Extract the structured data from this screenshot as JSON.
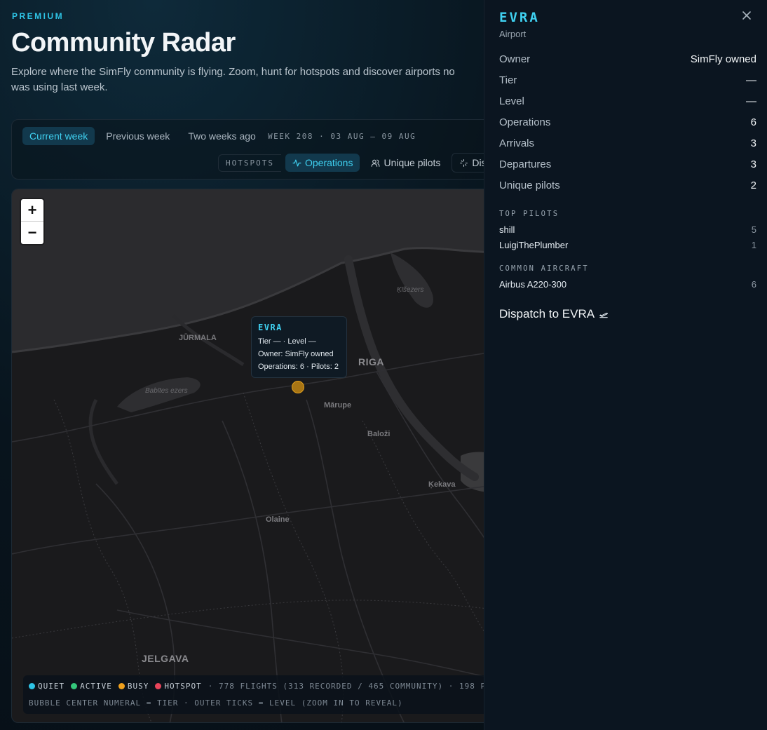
{
  "header": {
    "badge": "PREMIUM",
    "title": "Community Radar",
    "subtitle_line1": "Explore where the SimFly community is flying. Zoom, hunt for hotspots and discover airports no",
    "subtitle_line2": "was using last week."
  },
  "controls": {
    "week_tabs": [
      "Current week",
      "Previous week",
      "Two weeks ago"
    ],
    "active_week": "Current week",
    "week_range": "WEEK 208 · 03 AUG – 09 AUG",
    "hotspots_label": "HOTSPOTS",
    "metrics": [
      {
        "label": "Operations",
        "icon": "activity-icon",
        "active": true
      },
      {
        "label": "Unique pilots",
        "icon": "users-icon",
        "active": false
      },
      {
        "label": "Dis",
        "icon": "sparkle-icon",
        "active": false
      }
    ]
  },
  "map": {
    "zoom_in": "+",
    "zoom_out": "−",
    "places": {
      "jurmala": "JŪRMALA",
      "riga": "RIGA",
      "kisezers": "Ķīšezers",
      "babites": "Babītes ezers",
      "marupe": "Mārupe",
      "balozi": "Baloži",
      "kekava": "Ķekava",
      "olaine": "Olaine",
      "jelgava": "JELGAVA"
    },
    "tooltip": {
      "code": "EVRA",
      "line1": "Tier — · Level —",
      "line2": "Owner: SimFly owned",
      "line3": "Operations: 6 · Pilots: 2"
    },
    "bubble_status": "busy",
    "legend": {
      "items": [
        {
          "label": "QUIET",
          "color": "#2ec4e6"
        },
        {
          "label": "ACTIVE",
          "color": "#34c77b"
        },
        {
          "label": "BUSY",
          "color": "#f0a01c"
        },
        {
          "label": "HOTSPOT",
          "color": "#e8445a"
        }
      ],
      "stats": "· 778 FLIGHTS (313 RECORDED / 465 COMMUNITY) · 198 P",
      "note": "BUBBLE CENTER NUMERAL = TIER · OUTER TICKS = LEVEL (ZOOM IN TO REVEAL)"
    }
  },
  "panel": {
    "code": "EVRA",
    "type": "Airport",
    "close_icon": "close-icon",
    "stats": [
      {
        "label": "Owner",
        "value": "SimFly owned"
      },
      {
        "label": "Tier",
        "value": "—"
      },
      {
        "label": "Level",
        "value": "—"
      },
      {
        "label": "Operations",
        "value": "6"
      },
      {
        "label": "Arrivals",
        "value": "3"
      },
      {
        "label": "Departures",
        "value": "3"
      },
      {
        "label": "Unique pilots",
        "value": "2"
      }
    ],
    "top_pilots_title": "TOP PILOTS",
    "top_pilots": [
      {
        "name": "shill",
        "count": "5"
      },
      {
        "name": "LuigiThePlumber",
        "count": "1"
      }
    ],
    "common_aircraft_title": "COMMON AIRCRAFT",
    "aircraft": [
      {
        "name": "Airbus A220-300",
        "count": "6"
      }
    ],
    "dispatch_label": "Dispatch to EVRA"
  }
}
